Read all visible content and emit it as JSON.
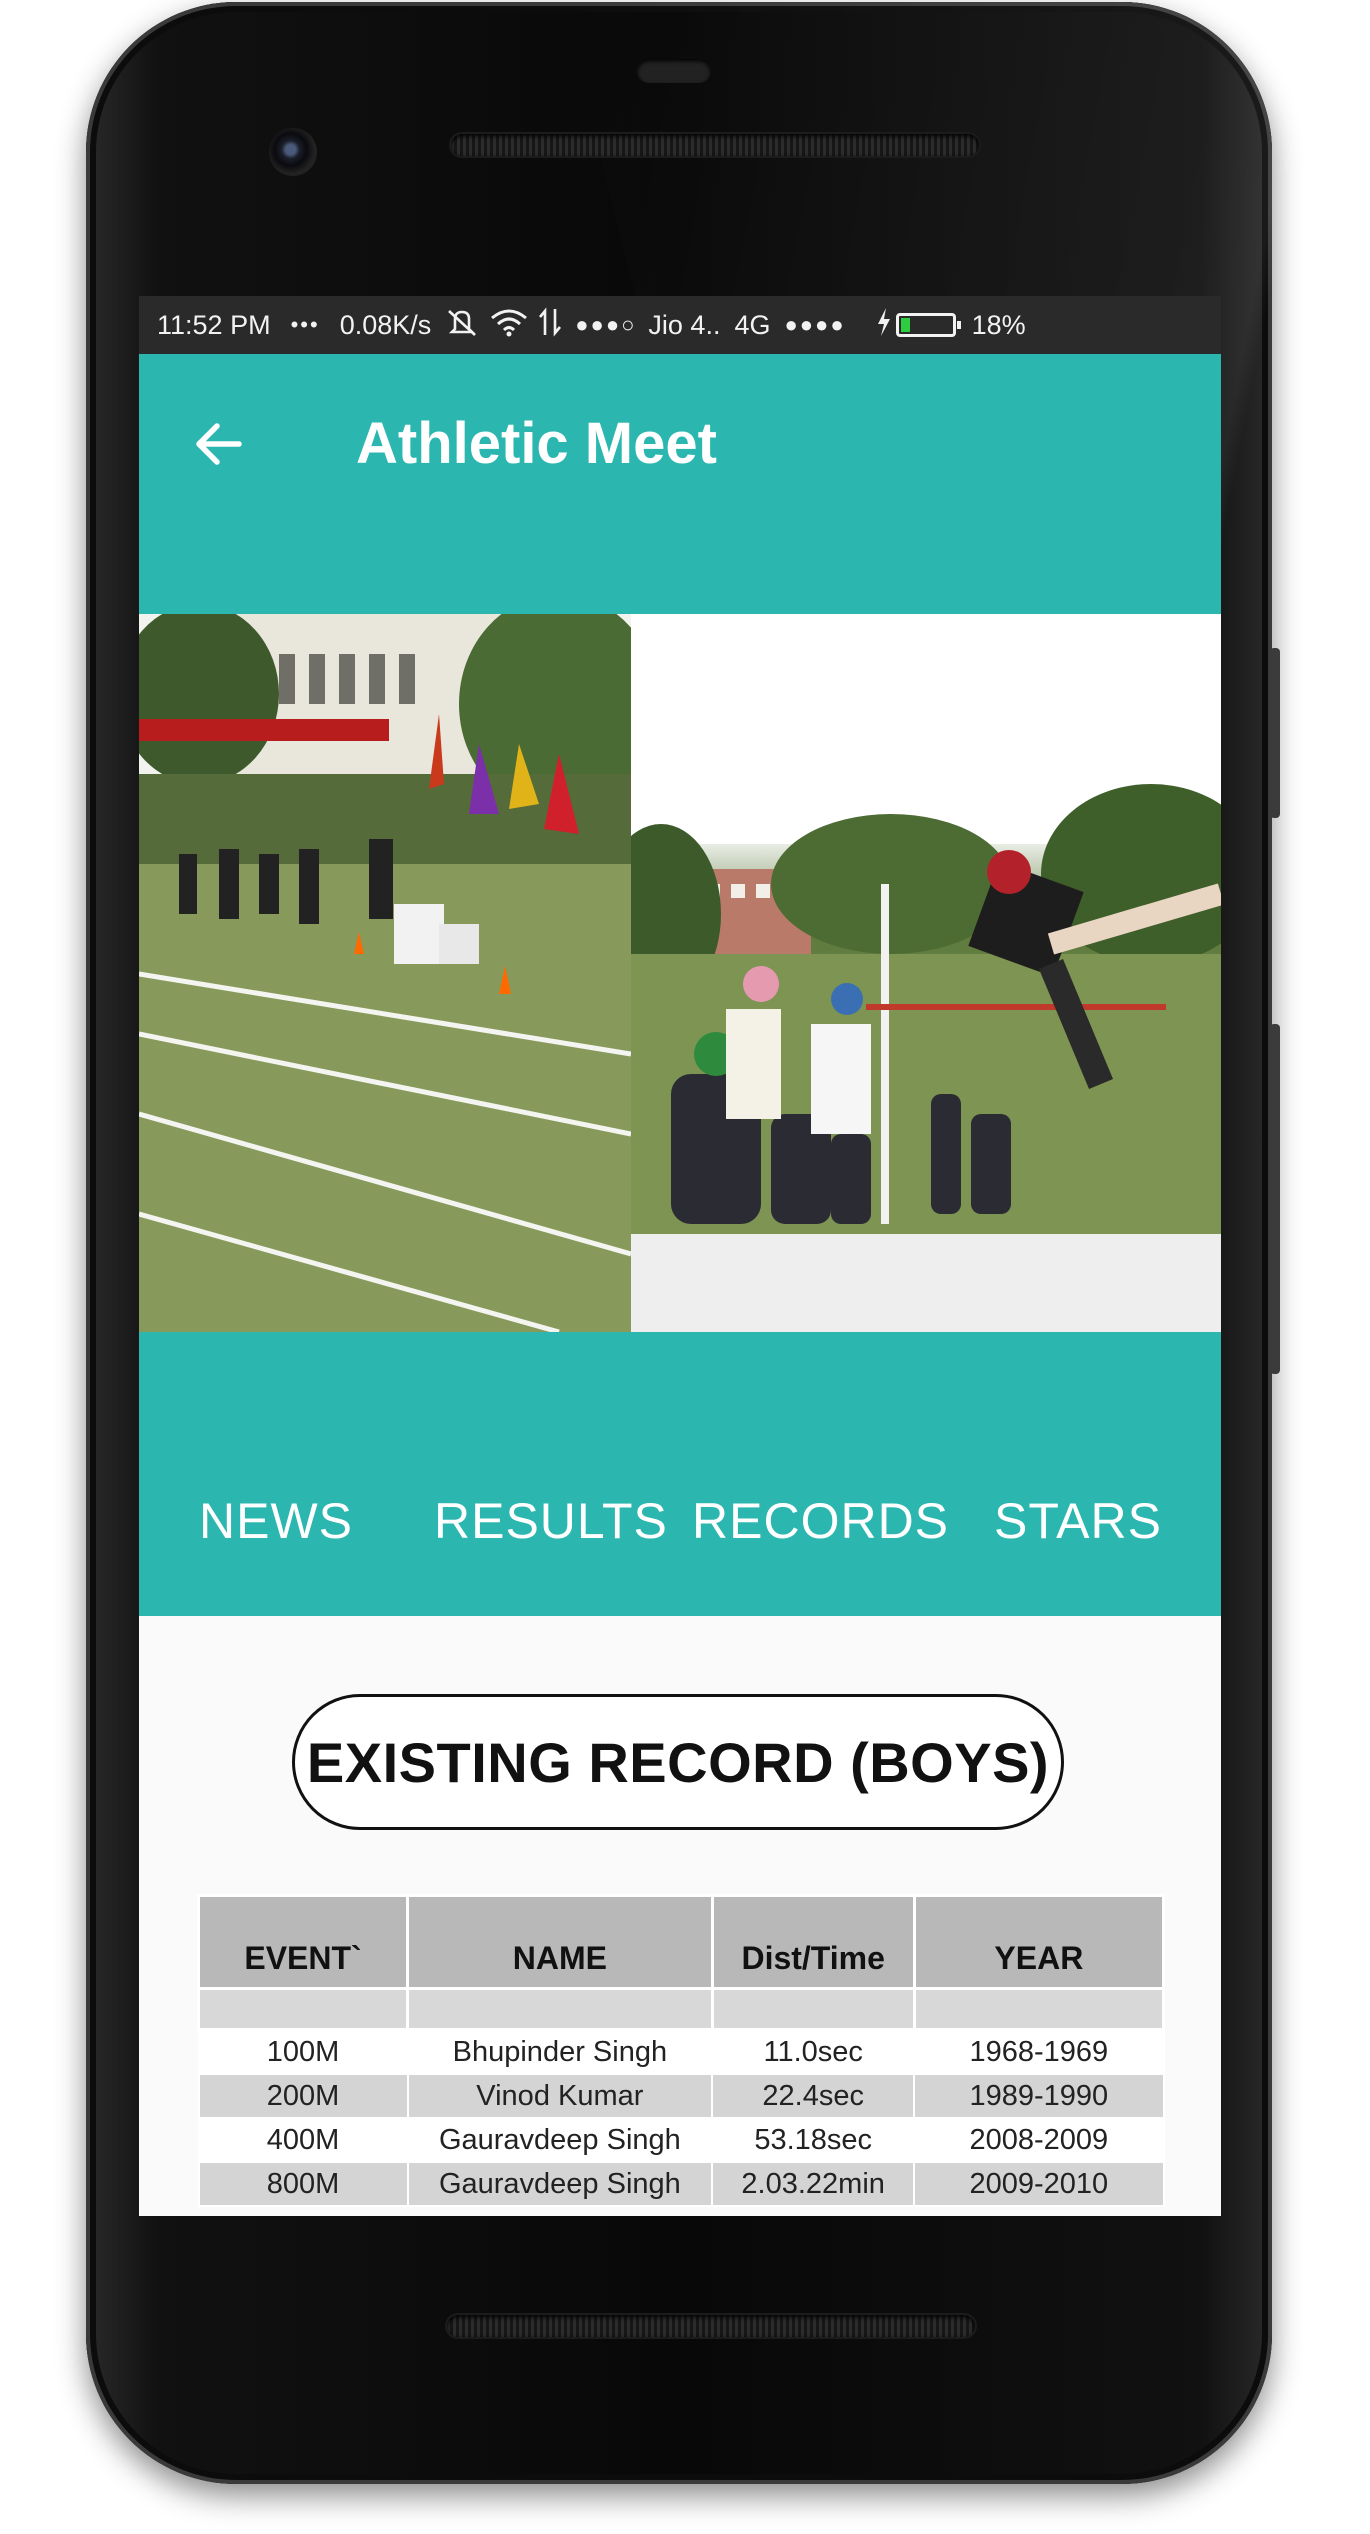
{
  "status_bar": {
    "time": "11:52 PM",
    "more": "•••",
    "speed": "0.08K/s",
    "signal_dots_1": "●●●○",
    "carrier": "Jio 4..",
    "network": "4G",
    "signal_dots_2": "●●●●",
    "battery_percent": "18%",
    "battery_level": 0.18
  },
  "app_bar": {
    "title": "Athletic Meet",
    "back_icon": "arrow-left-icon"
  },
  "tabs": [
    {
      "label": "NEWS"
    },
    {
      "label": "RESULTS"
    },
    {
      "label": "RECORDS"
    },
    {
      "label": "STARS"
    }
  ],
  "records": {
    "heading": "EXISTING RECORD (BOYS)",
    "columns": [
      "EVENT`",
      "NAME",
      "Dist/Time",
      "YEAR"
    ],
    "rows": [
      [
        "100M",
        "Bhupinder Singh",
        "11.0sec",
        "1968-1969"
      ],
      [
        "200M",
        "Vinod Kumar",
        "22.4sec",
        "1989-1990"
      ],
      [
        "400M",
        "Gauravdeep Singh",
        "53.18sec",
        "2008-2009"
      ],
      [
        "800M",
        "Gauravdeep Singh",
        "2.03.22min",
        "2009-2010"
      ]
    ]
  },
  "colors": {
    "primary": "#2bb7b0",
    "status_bar": "#2a2a2a",
    "table_header": "#b8b8b8"
  }
}
